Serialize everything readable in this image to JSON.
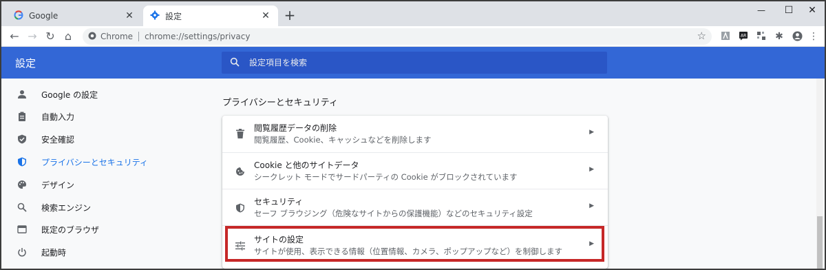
{
  "tabs": [
    {
      "title": "Google",
      "icon": "google-g-icon",
      "active": false
    },
    {
      "title": "設定",
      "icon": "gear-icon",
      "active": true
    }
  ],
  "new_tab_symbol": "+",
  "window_controls": {
    "minimize": "—",
    "maximize": "☐",
    "close": "✕"
  },
  "toolbar": {
    "origin": "Chrome",
    "url": "chrome://settings/privacy"
  },
  "header": {
    "title": "設定",
    "search_placeholder": "設定項目を検索"
  },
  "sidebar": {
    "items": [
      {
        "label": "Google の設定",
        "icon": "person-icon",
        "active": false
      },
      {
        "label": "自動入力",
        "icon": "clipboard-icon",
        "active": false
      },
      {
        "label": "安全確認",
        "icon": "shield-check-icon",
        "active": false
      },
      {
        "label": "プライバシーとセキュリティ",
        "icon": "shield-icon",
        "active": true
      },
      {
        "label": "デザイン",
        "icon": "palette-icon",
        "active": false
      },
      {
        "label": "検索エンジン",
        "icon": "search-icon",
        "active": false
      },
      {
        "label": "既定のブラウザ",
        "icon": "browser-icon",
        "active": false
      },
      {
        "label": "起動時",
        "icon": "power-icon",
        "active": false
      }
    ]
  },
  "main": {
    "section_title": "プライバシーとセキュリティ",
    "rows": [
      {
        "title": "閲覧履歴データの削除",
        "subtitle": "閲覧履歴、Cookie、キャッシュなどを削除します",
        "icon": "trash-icon"
      },
      {
        "title": "Cookie と他のサイトデータ",
        "subtitle": "シークレット モードでサードパーティの Cookie がブロックされています",
        "icon": "cookie-icon"
      },
      {
        "title": "セキュリティ",
        "subtitle": "セーフ ブラウジング（危険なサイトからの保護機能）などのセキュリティ設定",
        "icon": "shield-icon"
      },
      {
        "title": "サイトの設定",
        "subtitle": "サイトが使用、表示できる情報（位置情報、カメラ、ポップアップなど）を制御します",
        "icon": "sliders-icon"
      }
    ]
  },
  "colors": {
    "accent": "#1a73e8",
    "header": "#3367d6",
    "highlight": "#c62828"
  }
}
